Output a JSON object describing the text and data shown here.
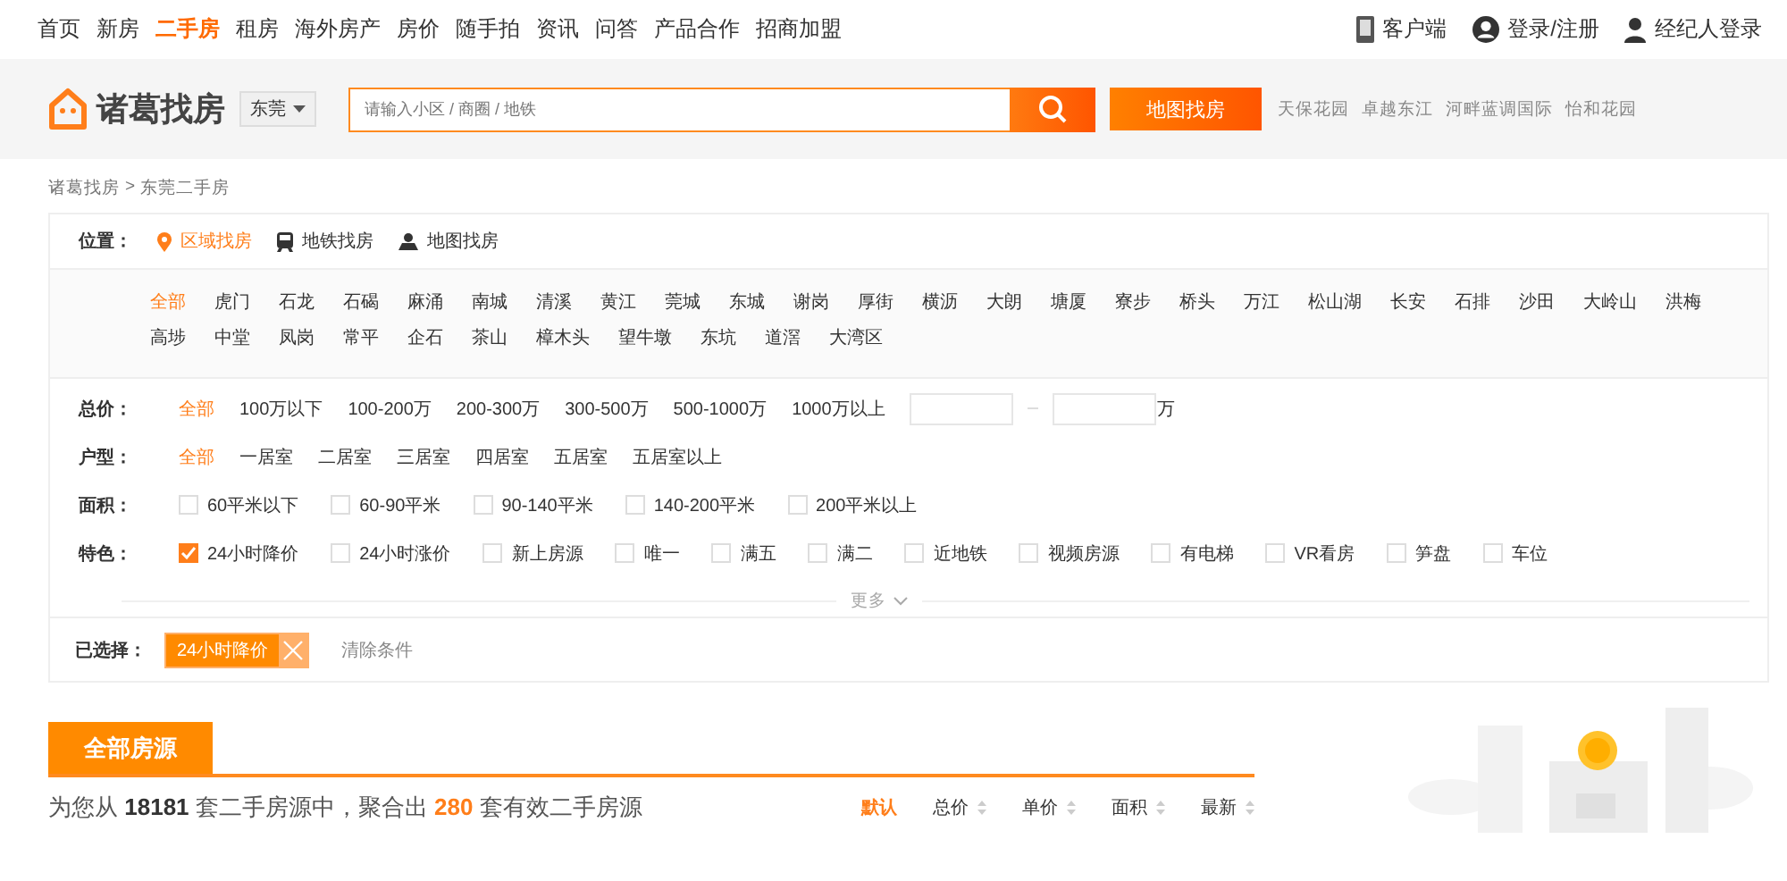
{
  "top_nav": {
    "items": [
      {
        "label": "首页",
        "selected": false
      },
      {
        "label": "新房",
        "selected": false
      },
      {
        "label": "二手房",
        "selected": true
      },
      {
        "label": "租房",
        "selected": false
      },
      {
        "label": "海外房产",
        "selected": false
      },
      {
        "label": "房价",
        "selected": false
      },
      {
        "label": "随手拍",
        "selected": false
      },
      {
        "label": "资讯",
        "selected": false
      },
      {
        "label": "问答",
        "selected": false
      },
      {
        "label": "产品合作",
        "selected": false
      },
      {
        "label": "招商加盟",
        "selected": false
      }
    ],
    "right": [
      {
        "label": "客户端",
        "kind": "phone"
      },
      {
        "label": "登录/注册",
        "kind": "avatar"
      },
      {
        "label": "经纪人登录",
        "kind": "person"
      }
    ]
  },
  "header": {
    "logo": "诸葛找房",
    "city": "东莞",
    "search_placeholder": "请输入小区 / 商圈 / 地铁",
    "map_button": "地图找房",
    "hot_tags": [
      "天保花园",
      "卓越东江",
      "河畔蓝调国际",
      "怡和花园"
    ]
  },
  "breadcrumb": {
    "items": [
      "诸葛找房",
      "东莞二手房"
    ],
    "separator": ">"
  },
  "location": {
    "label": "位置：",
    "tabs": [
      {
        "label": "区域找房",
        "kind": "pin",
        "selected": true
      },
      {
        "label": "地铁找房",
        "kind": "subway",
        "selected": false
      },
      {
        "label": "地图找房",
        "kind": "map",
        "selected": false
      }
    ],
    "districts": [
      [
        {
          "label": "全部",
          "selected": true
        },
        {
          "label": "虎门",
          "selected": false
        },
        {
          "label": "石龙",
          "selected": false
        },
        {
          "label": "石碣",
          "selected": false
        },
        {
          "label": "麻涌",
          "selected": false
        },
        {
          "label": "南城",
          "selected": false
        },
        {
          "label": "清溪",
          "selected": false
        },
        {
          "label": "黄江",
          "selected": false
        },
        {
          "label": "莞城",
          "selected": false
        },
        {
          "label": "东城",
          "selected": false
        },
        {
          "label": "谢岗",
          "selected": false
        },
        {
          "label": "厚街",
          "selected": false
        },
        {
          "label": "横沥",
          "selected": false
        },
        {
          "label": "大朗",
          "selected": false
        },
        {
          "label": "塘厦",
          "selected": false
        },
        {
          "label": "寮步",
          "selected": false
        },
        {
          "label": "桥头",
          "selected": false
        },
        {
          "label": "万江",
          "selected": false
        },
        {
          "label": "松山湖",
          "selected": false
        },
        {
          "label": "长安",
          "selected": false
        },
        {
          "label": "石排",
          "selected": false
        },
        {
          "label": "沙田",
          "selected": false
        },
        {
          "label": "大岭山",
          "selected": false
        },
        {
          "label": "洪梅",
          "selected": false
        }
      ],
      [
        {
          "label": "高埗",
          "selected": false
        },
        {
          "label": "中堂",
          "selected": false
        },
        {
          "label": "凤岗",
          "selected": false
        },
        {
          "label": "常平",
          "selected": false
        },
        {
          "label": "企石",
          "selected": false
        },
        {
          "label": "茶山",
          "selected": false
        },
        {
          "label": "樟木头",
          "selected": false
        },
        {
          "label": "望牛墩",
          "selected": false
        },
        {
          "label": "东坑",
          "selected": false
        },
        {
          "label": "道滘",
          "selected": false
        },
        {
          "label": "大湾区",
          "selected": false
        }
      ]
    ]
  },
  "price": {
    "label": "总价：",
    "options": [
      {
        "label": "全部",
        "selected": true
      },
      {
        "label": "100万以下",
        "selected": false
      },
      {
        "label": "100-200万",
        "selected": false
      },
      {
        "label": "200-300万",
        "selected": false
      },
      {
        "label": "300-500万",
        "selected": false
      },
      {
        "label": "500-1000万",
        "selected": false
      },
      {
        "label": "1000万以上",
        "selected": false
      }
    ],
    "unit": "万"
  },
  "rooms": {
    "label": "户型：",
    "options": [
      {
        "label": "全部",
        "selected": true
      },
      {
        "label": "一居室",
        "selected": false
      },
      {
        "label": "二居室",
        "selected": false
      },
      {
        "label": "三居室",
        "selected": false
      },
      {
        "label": "四居室",
        "selected": false
      },
      {
        "label": "五居室",
        "selected": false
      },
      {
        "label": "五居室以上",
        "selected": false
      }
    ]
  },
  "area": {
    "label": "面积：",
    "options": [
      {
        "label": "60平米以下",
        "checked": false
      },
      {
        "label": "60-90平米",
        "checked": false
      },
      {
        "label": "90-140平米",
        "checked": false
      },
      {
        "label": "140-200平米",
        "checked": false
      },
      {
        "label": "200平米以上",
        "checked": false
      }
    ]
  },
  "features": {
    "label": "特色：",
    "options": [
      {
        "label": "24小时降价",
        "checked": true
      },
      {
        "label": "24小时涨价",
        "checked": false
      },
      {
        "label": "新上房源",
        "checked": false
      },
      {
        "label": "唯一",
        "checked": false
      },
      {
        "label": "满五",
        "checked": false
      },
      {
        "label": "满二",
        "checked": false
      },
      {
        "label": "近地铁",
        "checked": false
      },
      {
        "label": "视频房源",
        "checked": false
      },
      {
        "label": "有电梯",
        "checked": false
      },
      {
        "label": "VR看房",
        "checked": false
      },
      {
        "label": "笋盘",
        "checked": false
      },
      {
        "label": "车位",
        "checked": false
      }
    ]
  },
  "more": "更多",
  "chosen": {
    "label": "已选择：",
    "tags": [
      "24小时降价"
    ],
    "clear": "清除条件"
  },
  "listing": {
    "tab": "全部房源",
    "summary": {
      "prefix": "为您从",
      "total": "18181",
      "middle": "套二手房源中，聚合出",
      "count": "280",
      "suffix": "套有效二手房源"
    },
    "sort": [
      {
        "label": "默认",
        "selected": true
      },
      {
        "label": "总价",
        "selected": false
      },
      {
        "label": "单价",
        "selected": false
      },
      {
        "label": "面积",
        "selected": false
      },
      {
        "label": "最新",
        "selected": false
      }
    ]
  }
}
